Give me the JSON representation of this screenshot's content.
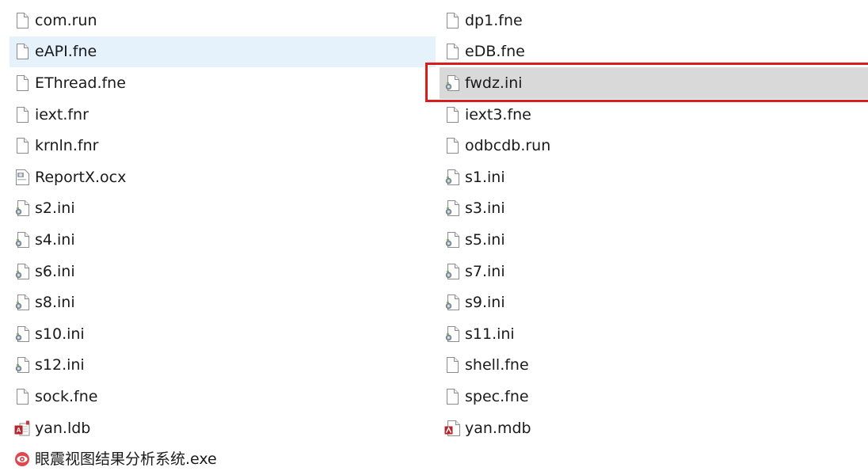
{
  "colors": {
    "hover_bg": "#e5f1fb",
    "selected_bg": "#d9d9d9",
    "annotation_border": "#d91c1c"
  },
  "files": {
    "left": [
      {
        "name": "com.run",
        "icon": "blank-file-icon"
      },
      {
        "name": "eAPI.fne",
        "icon": "blank-file-icon",
        "state": "hovered"
      },
      {
        "name": "EThread.fne",
        "icon": "blank-file-icon"
      },
      {
        "name": "iext.fnr",
        "icon": "blank-file-icon"
      },
      {
        "name": "krnln.fnr",
        "icon": "blank-file-icon"
      },
      {
        "name": "ReportX.ocx",
        "icon": "activex-control-icon"
      },
      {
        "name": "s2.ini",
        "icon": "config-file-icon"
      },
      {
        "name": "s4.ini",
        "icon": "config-file-icon"
      },
      {
        "name": "s6.ini",
        "icon": "config-file-icon"
      },
      {
        "name": "s8.ini",
        "icon": "config-file-icon"
      },
      {
        "name": "s10.ini",
        "icon": "config-file-icon"
      },
      {
        "name": "s12.ini",
        "icon": "config-file-icon"
      },
      {
        "name": "sock.fne",
        "icon": "blank-file-icon"
      },
      {
        "name": "yan.ldb",
        "icon": "access-lock-file-icon"
      },
      {
        "name": "眼震视图结果分析系统.exe",
        "icon": "app-exe-icon"
      }
    ],
    "right": [
      {
        "name": "dp1.fne",
        "icon": "blank-file-icon"
      },
      {
        "name": "eDB.fne",
        "icon": "blank-file-icon"
      },
      {
        "name": "fwdz.ini",
        "icon": "config-file-icon",
        "state": "selected"
      },
      {
        "name": "iext3.fne",
        "icon": "blank-file-icon"
      },
      {
        "name": "odbcdb.run",
        "icon": "blank-file-icon"
      },
      {
        "name": "s1.ini",
        "icon": "config-file-icon"
      },
      {
        "name": "s3.ini",
        "icon": "config-file-icon"
      },
      {
        "name": "s5.ini",
        "icon": "config-file-icon"
      },
      {
        "name": "s7.ini",
        "icon": "config-file-icon"
      },
      {
        "name": "s9.ini",
        "icon": "config-file-icon"
      },
      {
        "name": "s11.ini",
        "icon": "config-file-icon"
      },
      {
        "name": "shell.fne",
        "icon": "blank-file-icon"
      },
      {
        "name": "spec.fne",
        "icon": "blank-file-icon"
      },
      {
        "name": "yan.mdb",
        "icon": "access-database-icon"
      }
    ]
  }
}
